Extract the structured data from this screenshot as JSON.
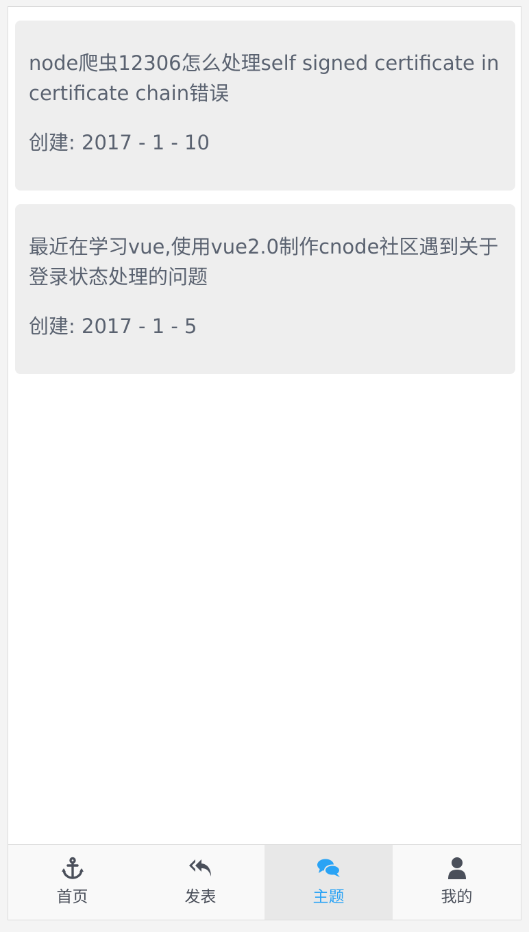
{
  "topics": [
    {
      "title": "node爬虫12306怎么处理self signed certificate in certificate chain错误",
      "created_label": "创建:",
      "created_date": "2017 - 1 - 10"
    },
    {
      "title": "最近在学习vue,使用vue2.0制作cnode社区遇到关于登录状态处理的问题",
      "created_label": "创建:",
      "created_date": "2017 - 1 - 5"
    }
  ],
  "tabbar": {
    "items": [
      {
        "label": "首页",
        "icon": "anchor-icon",
        "active": false
      },
      {
        "label": "发表",
        "icon": "reply-all-icon",
        "active": false
      },
      {
        "label": "主题",
        "icon": "comments-icon",
        "active": true
      },
      {
        "label": "我的",
        "icon": "user-icon",
        "active": false
      }
    ]
  },
  "colors": {
    "card_bg": "#eeeeee",
    "text": "#5a6270",
    "active_tab": "#2aa3f5",
    "active_tab_bg": "#e8e8e8"
  }
}
